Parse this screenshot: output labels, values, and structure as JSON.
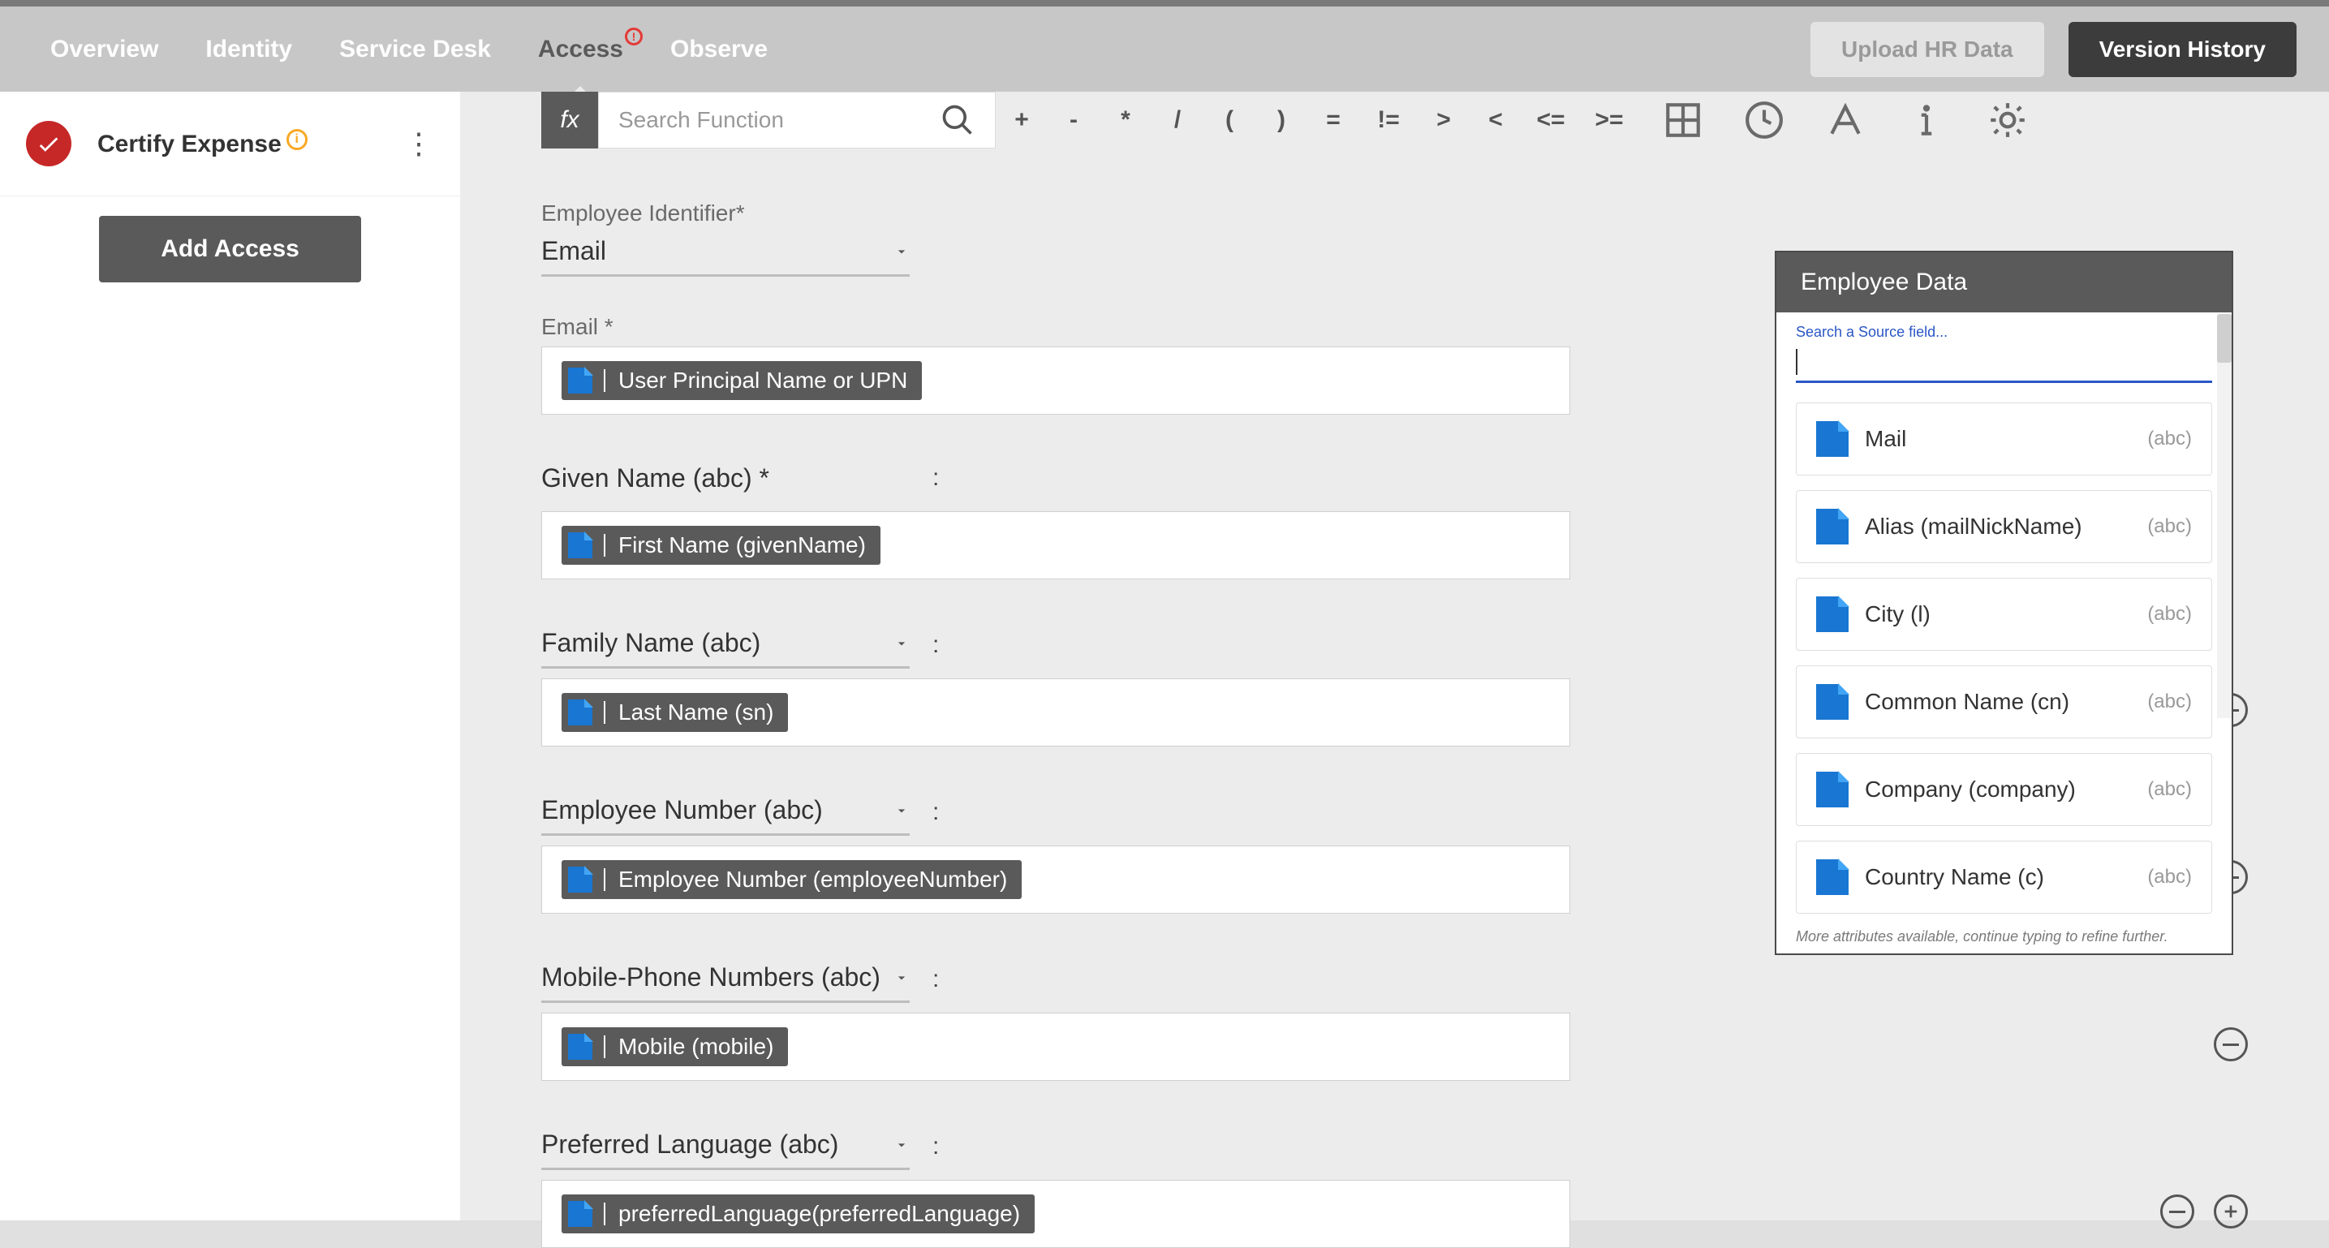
{
  "nav": {
    "tabs": [
      "Overview",
      "Identity",
      "Service Desk",
      "Access",
      "Observe"
    ],
    "activeIndex": 3,
    "uploadLabel": "Upload HR Data",
    "versionLabel": "Version History"
  },
  "sidebar": {
    "itemLabel": "Certify Expense",
    "addAccessLabel": "Add Access"
  },
  "formula": {
    "searchPlaceholder": "Search Function",
    "ops": [
      "+",
      "-",
      "*",
      "/",
      "(",
      ")",
      "=",
      "!=",
      ">",
      "<",
      "<=",
      ">="
    ]
  },
  "form": {
    "identifierLabel": "Employee Identifier",
    "identifierValue": "Email",
    "emailLabel": "Email *",
    "emailChip": "User Principal Name or UPN",
    "fields": [
      {
        "label": "Given Name (abc) *",
        "chip": "First Name (givenName)",
        "removable": false
      },
      {
        "label": "Family Name (abc)",
        "chip": "Last Name (sn)",
        "removable": true
      },
      {
        "label": "Employee Number (abc)",
        "chip": "Employee Number (employeeNumber)",
        "removable": true
      },
      {
        "label": "Mobile-Phone Numbers (abc)",
        "chip": "Mobile (mobile)",
        "removable": true
      },
      {
        "label": "Preferred Language (abc)",
        "chip": "preferredLanguage(preferredLanguage)",
        "removable": true,
        "addable": true
      }
    ]
  },
  "panel": {
    "title": "Employee Data",
    "searchPlaceholder": "Search a Source field...",
    "footer": "More attributes available, continue typing to refine further.",
    "attrs": [
      {
        "name": "Mail",
        "type": "(abc)"
      },
      {
        "name": "Alias (mailNickName)",
        "type": "(abc)"
      },
      {
        "name": "City (l)",
        "type": "(abc)"
      },
      {
        "name": "Common Name (cn)",
        "type": "(abc)"
      },
      {
        "name": "Company (company)",
        "type": "(abc)"
      },
      {
        "name": "Country Name (c)",
        "type": "(abc)"
      }
    ]
  }
}
